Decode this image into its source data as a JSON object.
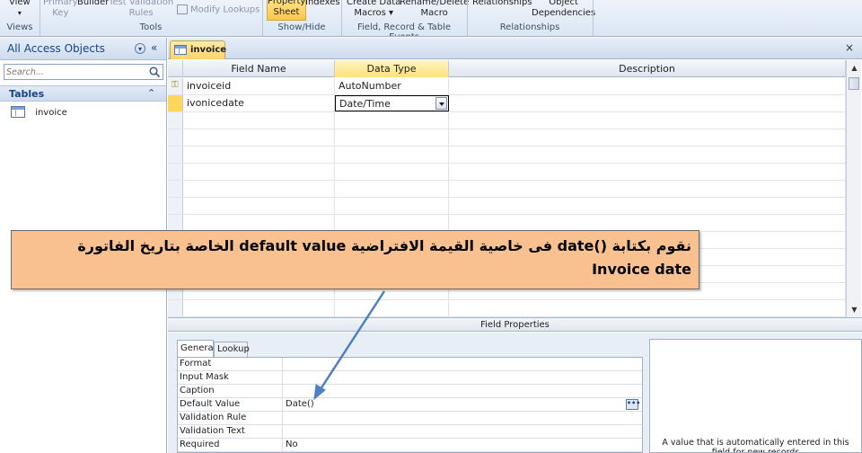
{
  "ribbon": {
    "views": {
      "view_label": "View",
      "group": "Views"
    },
    "tools": {
      "primary_key": "Primary\nKey",
      "builder": "Builder",
      "test_validation": "Test Validation\nRules",
      "modify_lookups": "Modify Lookups",
      "group": "Tools"
    },
    "showhide": {
      "property_sheet": "Property\nSheet",
      "indexes": "Indexes",
      "group": "Show/Hide"
    },
    "events": {
      "create_data_macros": "Create Data\nMacros ▾",
      "rename_delete_macro": "Rename/Delete\nMacro",
      "group": "Field, Record & Table Events"
    },
    "relationships": {
      "relationships": "Relationships",
      "object_dependencies": "Object\nDependencies",
      "group": "Relationships"
    }
  },
  "nav": {
    "title": "All Access Objects",
    "dropdown_glyph": "▾",
    "collapse_glyph": "«",
    "search_placeholder": "Search...",
    "section": "Tables",
    "section_chevron": "⌃",
    "items": [
      {
        "label": "invoice"
      }
    ]
  },
  "doc": {
    "tab_label": "invoice",
    "close_glyph": "×",
    "columns": {
      "field_name": "Field Name",
      "data_type": "Data Type",
      "description": "Description"
    },
    "rows": [
      {
        "field": "invoiceid",
        "type": "AutoNumber",
        "description": ""
      },
      {
        "field": "ivonicedate",
        "type": "Date/Time",
        "description": ""
      }
    ],
    "field_properties_title": "Field Properties",
    "tabs": {
      "general": "General",
      "lookup": "Lookup"
    },
    "properties": [
      {
        "label": "Format",
        "value": ""
      },
      {
        "label": "Input Mask",
        "value": ""
      },
      {
        "label": "Caption",
        "value": ""
      },
      {
        "label": "Default Value",
        "value": "Date()"
      },
      {
        "label": "Validation Rule",
        "value": ""
      },
      {
        "label": "Validation Text",
        "value": ""
      },
      {
        "label": "Required",
        "value": "No"
      }
    ],
    "help_text": "A value that is automatically entered in this field for new records"
  },
  "callout": {
    "line1": "نقوم بكتابة ()date  فى خاصية القيمة الافتراضية default value الخاصة بتاريخ الفاتورة",
    "line2": "Invoice date"
  },
  "colors": {
    "accent_tab": "#ffd36b",
    "callout_fill": "#f8c18f",
    "arrow": "#4f7fc1"
  }
}
